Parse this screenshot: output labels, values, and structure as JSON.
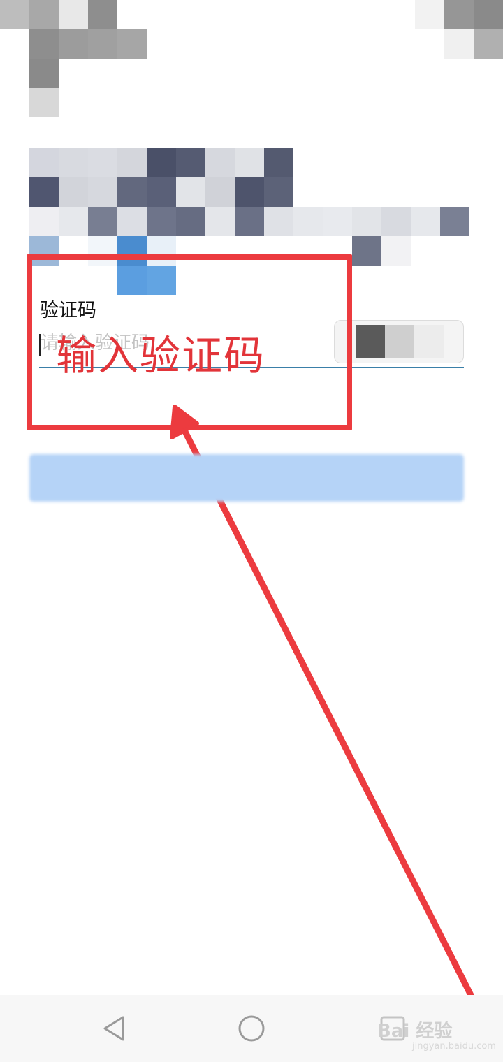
{
  "form": {
    "code_label": "验证码",
    "code_placeholder": "请输入验证码",
    "code_value": ""
  },
  "annotation": {
    "text": "输入验证码"
  },
  "navbar": {
    "back_icon": "triangle-back-icon",
    "home_icon": "circle-home-icon",
    "recent_icon": "square-recent-icon"
  },
  "watermark": {
    "text": "Bai 经验",
    "sub": "jingyan.baidu.com"
  },
  "colors": {
    "annotation_red": "#ec3b3f",
    "underline": "#3a7fa8",
    "button_blue": "#b5d3f7"
  }
}
